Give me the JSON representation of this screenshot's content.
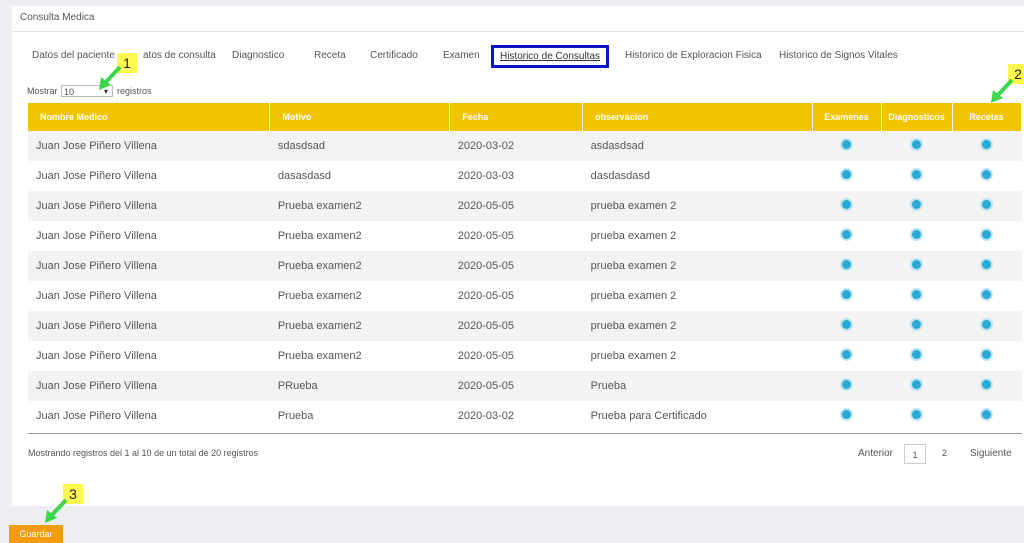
{
  "panel": {
    "title": "Consulta Medica"
  },
  "tabs": [
    {
      "label": "Datos del paciente"
    },
    {
      "label": "atos de consulta"
    },
    {
      "label": "Diagnostico"
    },
    {
      "label": "Receta"
    },
    {
      "label": "Certificado"
    },
    {
      "label": "Examen"
    },
    {
      "label": "Historico de Consultas"
    },
    {
      "label": "Historico de Exploracion Fisica"
    },
    {
      "label": "Historico de Signos Vitales"
    }
  ],
  "length": {
    "prefix": "Mostrar",
    "value": "10",
    "suffix": "registros"
  },
  "table": {
    "headers": [
      "Nombre Medico",
      "Motivo",
      "Fecha",
      "observacion",
      "Examenes",
      "Diagnosticos",
      "Recetas"
    ],
    "rows": [
      [
        "Juan Jose Piñero Villena",
        "sdasdsad",
        "2020-03-02",
        "asdasdsad"
      ],
      [
        "Juan Jose Piñero Villena",
        "dasasdasd",
        "2020-03-03",
        "dasdasdasd"
      ],
      [
        "Juan Jose Piñero Villena",
        "Prueba examen2",
        "2020-05-05",
        "prueba examen 2"
      ],
      [
        "Juan Jose Piñero Villena",
        "Prueba examen2",
        "2020-05-05",
        "prueba examen 2"
      ],
      [
        "Juan Jose Piñero Villena",
        "Prueba examen2",
        "2020-05-05",
        "prueba examen 2"
      ],
      [
        "Juan Jose Piñero Villena",
        "Prueba examen2",
        "2020-05-05",
        "prueba examen 2"
      ],
      [
        "Juan Jose Piñero Villena",
        "Prueba examen2",
        "2020-05-05",
        "prueba examen 2"
      ],
      [
        "Juan Jose Piñero Villena",
        "Prueba examen2",
        "2020-05-05",
        "prueba examen 2"
      ],
      [
        "Juan Jose Piñero Villena",
        "PRueba",
        "2020-05-05",
        "Prueba"
      ],
      [
        "Juan Jose Piñero Villena",
        "Prueba",
        "2020-03-02",
        "Prueba para Certificado"
      ]
    ]
  },
  "footer": {
    "info": "Mostrando registros del 1 al 10 de un total de 20 registros"
  },
  "pager": {
    "prev": "Anterior",
    "page1": "1",
    "page2": "2",
    "next": "Siguiente"
  },
  "actions": {
    "save": "Guardar"
  },
  "callouts": [
    "1",
    "2",
    "3"
  ],
  "colors": {
    "header": "#f2c400",
    "highlight_box": "#0b16c8",
    "callout": "#fff94f",
    "arrow": "#3bd64a",
    "save": "#f39c12",
    "icon": "#2aa9d4"
  },
  "icons": {
    "row_action": "view-dot-icon",
    "arrow": "green-arrow-icon"
  }
}
